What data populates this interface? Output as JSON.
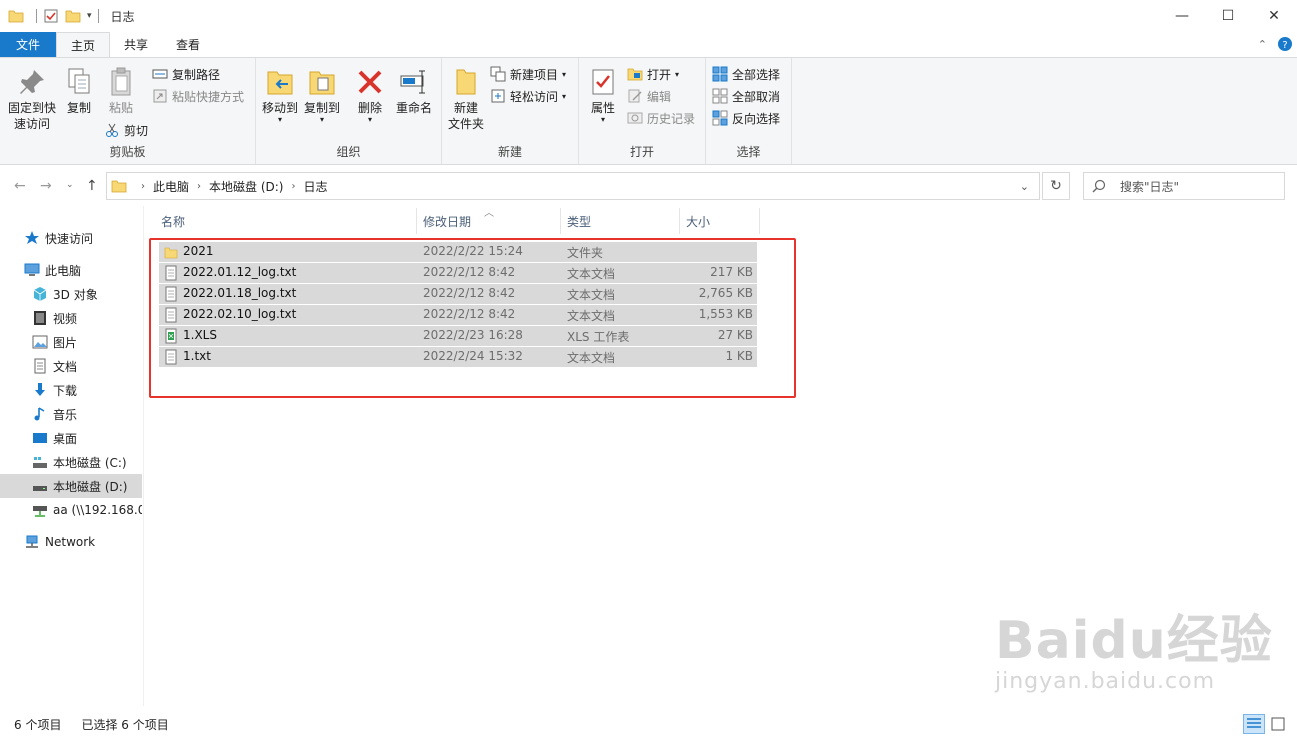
{
  "window": {
    "title": "日志",
    "controls": {
      "minimize": "—",
      "maximize": "☐",
      "close": "✕"
    }
  },
  "ribbon_tabs": [
    "文件",
    "主页",
    "共享",
    "查看"
  ],
  "ribbon": {
    "clipboard": {
      "label": "剪贴板",
      "pin": "固定到快\n速访问",
      "copy": "复制",
      "paste": "粘贴",
      "copy_path": "复制路径",
      "paste_shortcut": "粘贴快捷方式",
      "cut": "剪切"
    },
    "organize": {
      "label": "组织",
      "move_to": "移动到",
      "copy_to": "复制到",
      "delete": "删除",
      "rename": "重命名"
    },
    "new": {
      "label": "新建",
      "new_folder": "新建\n文件夹",
      "new_item": "新建项目",
      "easy_access": "轻松访问"
    },
    "open": {
      "label": "打开",
      "properties": "属性",
      "open": "打开",
      "edit": "编辑",
      "history": "历史记录"
    },
    "select": {
      "label": "选择",
      "select_all": "全部选择",
      "select_none": "全部取消",
      "invert": "反向选择"
    }
  },
  "address": {
    "crumbs": [
      "此电脑",
      "本地磁盘 (D:)",
      "日志"
    ],
    "search_placeholder": "搜索\"日志\""
  },
  "sidebar": {
    "items": [
      {
        "label": "快速访问",
        "icon": "star-icon"
      },
      {
        "label": "此电脑",
        "icon": "computer-icon"
      },
      {
        "label": "3D 对象",
        "icon": "cube-icon"
      },
      {
        "label": "视频",
        "icon": "video-icon"
      },
      {
        "label": "图片",
        "icon": "picture-icon"
      },
      {
        "label": "文档",
        "icon": "document-icon"
      },
      {
        "label": "下载",
        "icon": "download-icon"
      },
      {
        "label": "音乐",
        "icon": "music-icon"
      },
      {
        "label": "桌面",
        "icon": "desktop-icon"
      },
      {
        "label": "本地磁盘 (C:)",
        "icon": "drive-icon"
      },
      {
        "label": "本地磁盘 (D:)",
        "icon": "drive-icon"
      },
      {
        "label": "aa (\\\\192.168.0",
        "icon": "network-drive-icon"
      },
      {
        "label": "Network",
        "icon": "network-icon"
      }
    ]
  },
  "columns": {
    "name": "名称",
    "date": "修改日期",
    "type": "类型",
    "size": "大小"
  },
  "files": [
    {
      "name": "2021",
      "date": "2022/2/22 15:24",
      "type": "文件夹",
      "size": "",
      "icon": "folder-icon"
    },
    {
      "name": "2022.01.12_log.txt",
      "date": "2022/2/12 8:42",
      "type": "文本文档",
      "size": "217 KB",
      "icon": "text-file-icon"
    },
    {
      "name": "2022.01.18_log.txt",
      "date": "2022/2/12 8:42",
      "type": "文本文档",
      "size": "2,765 KB",
      "icon": "text-file-icon"
    },
    {
      "name": "2022.02.10_log.txt",
      "date": "2022/2/12 8:42",
      "type": "文本文档",
      "size": "1,553 KB",
      "icon": "text-file-icon"
    },
    {
      "name": "1.XLS",
      "date": "2022/2/23 16:28",
      "type": "XLS 工作表",
      "size": "27 KB",
      "icon": "spreadsheet-icon"
    },
    {
      "name": "1.txt",
      "date": "2022/2/24 15:32",
      "type": "文本文档",
      "size": "1 KB",
      "icon": "text-file-icon"
    }
  ],
  "status": {
    "count": "6 个项目",
    "selected": "已选择 6 个项目"
  },
  "watermark": {
    "main": "Baidu经验",
    "sub": "jingyan.baidu.com"
  },
  "colors": {
    "accent": "#1979ca",
    "selection": "#d9d9d9",
    "highlight_box": "#e8322c",
    "folder": "#f8d775"
  }
}
